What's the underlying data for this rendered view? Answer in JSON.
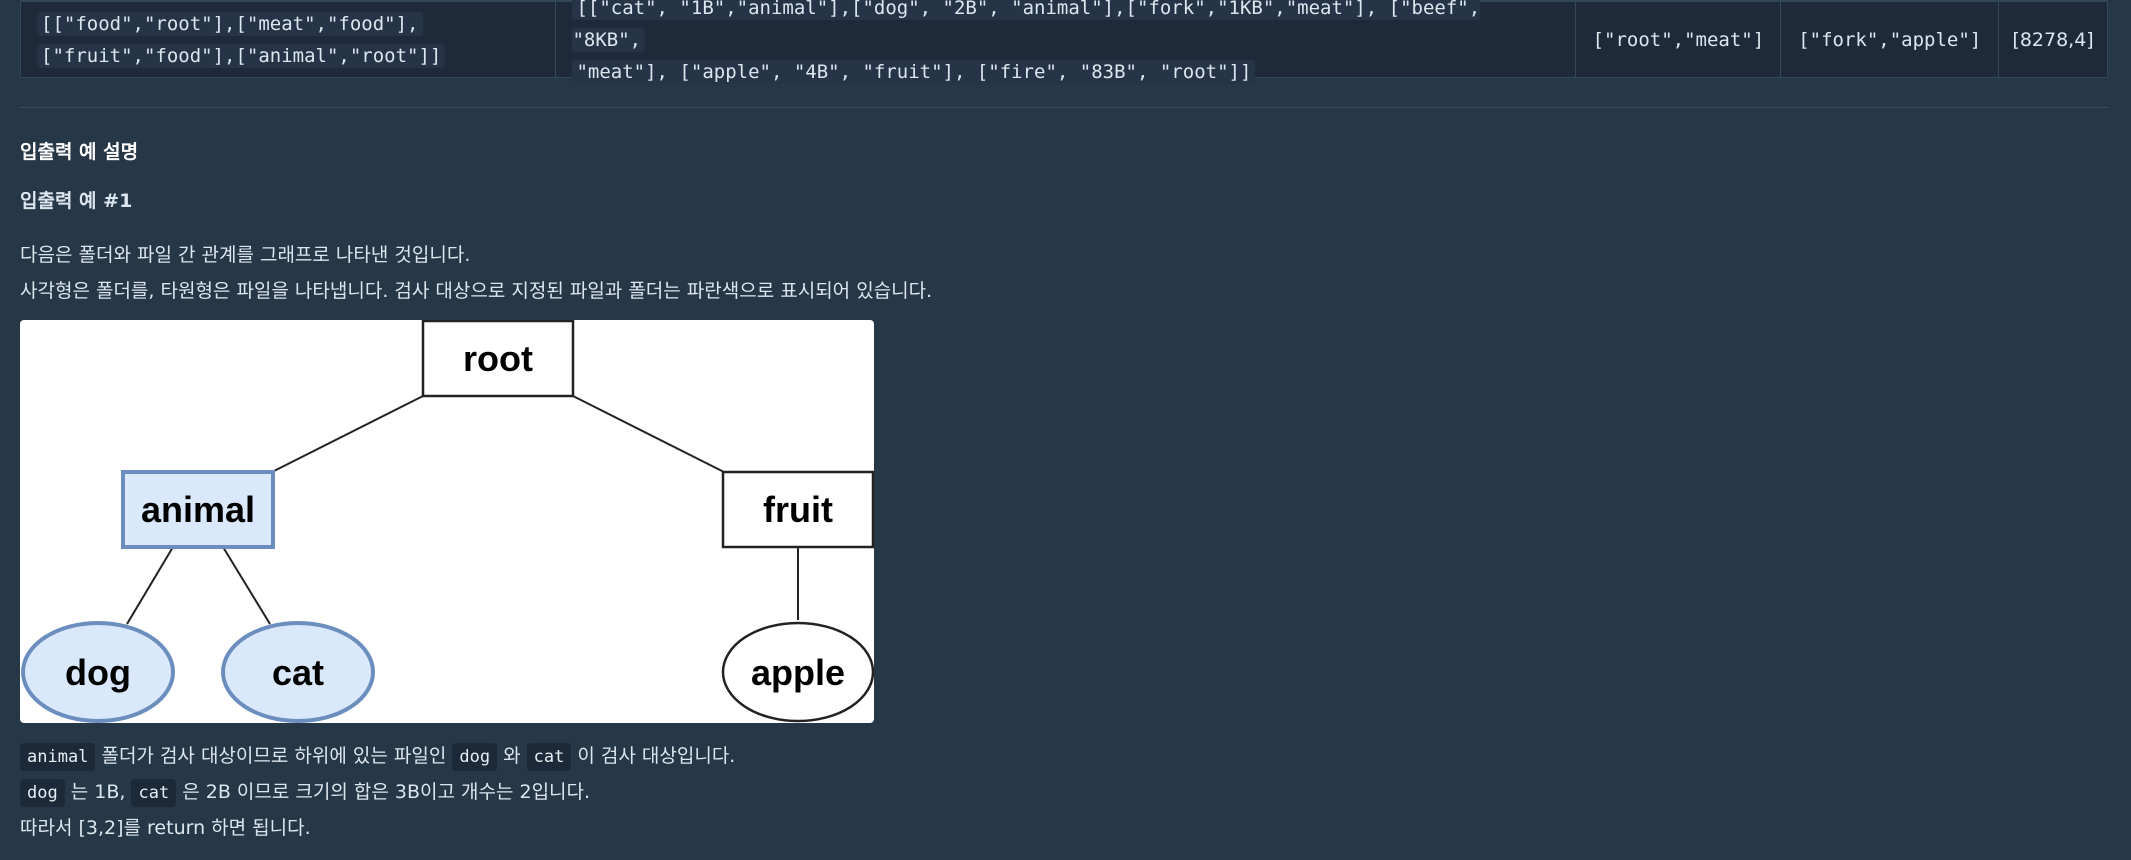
{
  "example_row": {
    "folders": [
      "[[\"food\",\"root\"],[\"meat\",\"food\"],",
      "[\"fruit\",\"food\"],[\"animal\",\"root\"]]"
    ],
    "files": [
      "[[\"cat\", \"1B\",\"animal\"],[\"dog\", \"2B\", \"animal\"],[\"fork\",\"1KB\",\"meat\"], [\"beef\", \"8KB\",",
      "\"meat\"], [\"apple\", \"4B\", \"fruit\"], [\"fire\", \"83B\", \"root\"]]"
    ],
    "target_folders": "[\"root\",\"meat\"]",
    "target_files": "[\"fork\",\"apple\"]",
    "result": "[8278,4]"
  },
  "section": {
    "title": "입출력 예 설명",
    "example_title": "입출력 예 #1",
    "desc_line1": "다음은 폴더와 파일 간 관계를 그래프로 나타낸 것입니다.",
    "desc_line2": "사각형은 폴더를, 타원형은 파일을 나타냅니다. 검사 대상으로 지정된 파일과 폴더는 파란색으로 표시되어 있습니다."
  },
  "tree": {
    "root": "root",
    "animal": "animal",
    "fruit": "fruit",
    "dog": "dog",
    "cat": "cat",
    "apple": "apple",
    "highlight_fill": "#dae8fc",
    "highlight_stroke": "#6c8ebf"
  },
  "explanation": {
    "line1_code1": "animal",
    "line1_text1": " 폴더가 검사 대상이므로 하위에 있는 파일인 ",
    "line1_code2": "dog",
    "line1_text2": " 와 ",
    "line1_code3": "cat",
    "line1_text3": " 이 검사 대상입니다.",
    "line2_code1": "dog",
    "line2_text1": " 는 1B, ",
    "line2_code2": "cat",
    "line2_text2": " 은 2B 이므로 크기의 합은 3B이고 개수는 2입니다.",
    "line3": "따라서 [3,2]를 return 하면 됩니다."
  }
}
